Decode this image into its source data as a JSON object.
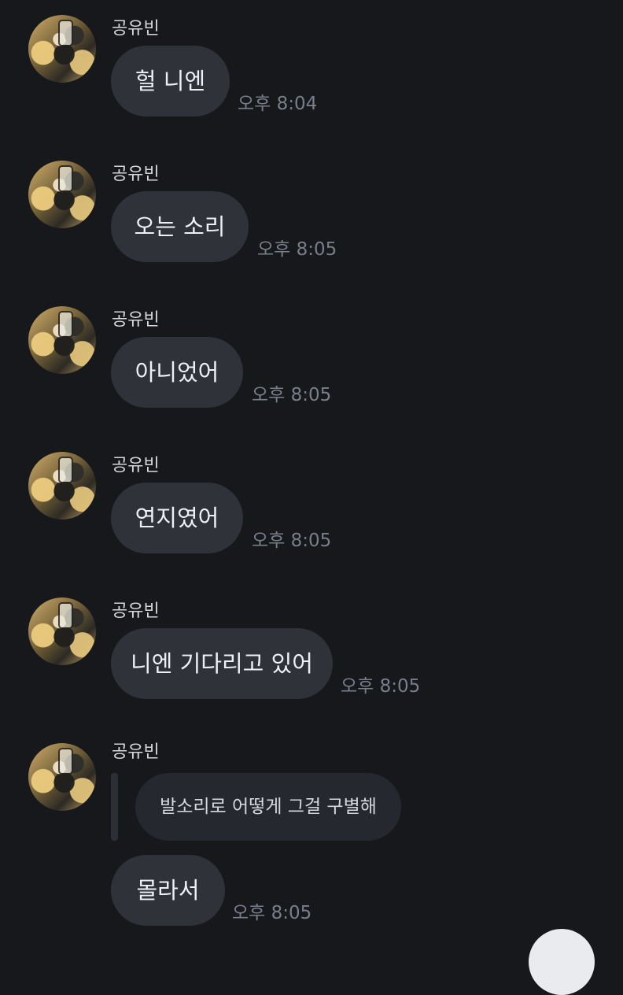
{
  "messages": [
    {
      "sender": "공유빈",
      "text": "헐 니엔",
      "time": "오후 8:04"
    },
    {
      "sender": "공유빈",
      "text": "오는 소리",
      "time": "오후 8:05"
    },
    {
      "sender": "공유빈",
      "text": "아니었어",
      "time": "오후 8:05"
    },
    {
      "sender": "공유빈",
      "text": "연지였어",
      "time": "오후 8:05"
    },
    {
      "sender": "공유빈",
      "text": "니엔 기다리고 있어",
      "time": "오후 8:05"
    },
    {
      "sender": "공유빈",
      "quoted_text": "발소리로 어떻게 그걸 구별해",
      "text": "몰라서",
      "time": "오후 8:05"
    }
  ],
  "icons": {
    "avatar": "profile-photo",
    "scroll_button": "scroll-down-button"
  },
  "colors": {
    "background": "#17181c",
    "bubble": "#30323a",
    "quote_bubble": "#262830",
    "sender_text": "#d6d7db",
    "time_text": "#7a7e88"
  }
}
